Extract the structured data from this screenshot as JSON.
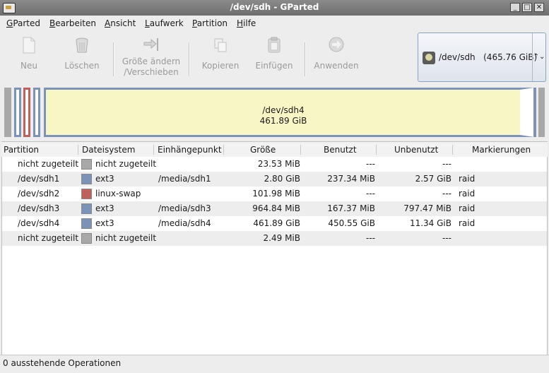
{
  "window": {
    "title": "/dev/sdh - GParted"
  },
  "menu": [
    {
      "mnemonic": "G",
      "rest": "Parted"
    },
    {
      "mnemonic": "B",
      "rest": "earbeiten"
    },
    {
      "mnemonic": "A",
      "rest": "nsicht"
    },
    {
      "mnemonic": "L",
      "rest": "aufwerk"
    },
    {
      "mnemonic": "P",
      "rest": "artition"
    },
    {
      "mnemonic": "H",
      "rest": "ilfe"
    }
  ],
  "toolbar": {
    "new": "Neu",
    "delete": "Löschen",
    "resize_line1": "Größe ändern",
    "resize_line2": "/Verschieben",
    "copy": "Kopieren",
    "paste": "Einfügen",
    "apply": "Anwenden"
  },
  "device": {
    "name": "/dev/sdh",
    "size": "(465.76 GiB)"
  },
  "visual": {
    "selected_name": "/dev/sdh4",
    "selected_size": "461.89 GiB"
  },
  "columns": [
    "Partition",
    "Dateisystem",
    "Einhängepunkt",
    "Größe",
    "Benutzt",
    "Unbenutzt",
    "Markierungen"
  ],
  "rows": [
    {
      "partition": "nicht zugeteilt",
      "fs": "nicht zugeteilt",
      "mount": "",
      "size": "23.53 MiB",
      "used": "---",
      "unused": "---",
      "flags": "",
      "color": "#a8a8a8"
    },
    {
      "partition": "/dev/sdh1",
      "fs": "ext3",
      "mount": "/media/sdh1",
      "size": "2.80 GiB",
      "used": "237.34 MiB",
      "unused": "2.57 GiB",
      "flags": "raid",
      "color": "#7b93b9"
    },
    {
      "partition": "/dev/sdh2",
      "fs": "linux-swap",
      "mount": "",
      "size": "101.98 MiB",
      "used": "---",
      "unused": "---",
      "flags": "raid",
      "color": "#c0605a"
    },
    {
      "partition": "/dev/sdh3",
      "fs": "ext3",
      "mount": "/media/sdh3",
      "size": "964.84 MiB",
      "used": "167.37 MiB",
      "unused": "797.47 MiB",
      "flags": "raid",
      "color": "#7b93b9"
    },
    {
      "partition": "/dev/sdh4",
      "fs": "ext3",
      "mount": "/media/sdh4",
      "size": "461.89 GiB",
      "used": "450.55 GiB",
      "unused": "11.34 GiB",
      "flags": "raid",
      "color": "#7b93b9"
    },
    {
      "partition": "nicht zugeteilt",
      "fs": "nicht zugeteilt",
      "mount": "",
      "size": "2.49 MiB",
      "used": "---",
      "unused": "---",
      "flags": "",
      "color": "#a8a8a8"
    }
  ],
  "status": {
    "text": "0 ausstehende Operationen"
  }
}
